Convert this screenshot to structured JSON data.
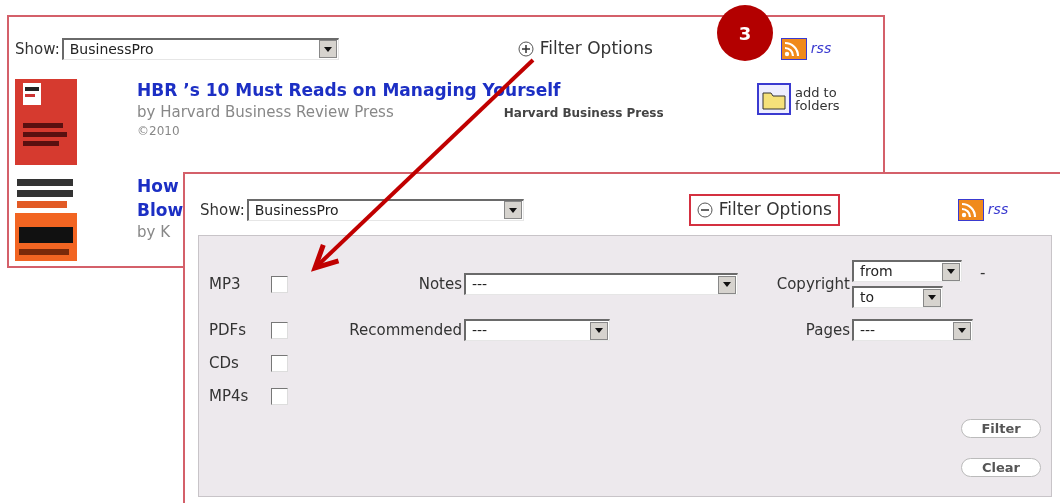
{
  "step_badge": "3",
  "results_panel": {
    "show": {
      "label": "Show:",
      "value": "BusinessPro"
    },
    "filter_toggle": {
      "label": "Filter Options",
      "expanded": false,
      "highlighted": false
    },
    "rss": "rss",
    "results": [
      {
        "title_lines": [
          "HBR ’s 10 Must Reads on Managing Yourself"
        ],
        "byline": "by Harvard Business Review Press",
        "publisher": "Harvard Business Press",
        "copyright": "©2010",
        "action": "add to folders"
      },
      {
        "title_lines": [
          "How",
          "Blow"
        ],
        "byline": "by K"
      }
    ]
  },
  "filter_panel": {
    "show": {
      "label": "Show:",
      "value": "BusinessPro"
    },
    "filter_toggle": {
      "label": "Filter Options",
      "expanded": true,
      "highlighted": true
    },
    "rss": "rss",
    "checkboxes": [
      {
        "label": "MP3",
        "checked": false
      },
      {
        "label": "PDFs",
        "checked": false
      },
      {
        "label": "CDs",
        "checked": false
      },
      {
        "label": "MP4s",
        "checked": false
      }
    ],
    "notes": {
      "label": "Notes",
      "value": "---"
    },
    "recommended": {
      "label": "Recommended",
      "value": "---"
    },
    "copyright": {
      "label": "Copyright",
      "from": "from",
      "to": "to",
      "separator": "-"
    },
    "pages": {
      "label": "Pages",
      "value": "---"
    },
    "buttons": [
      "Filter",
      "Clear"
    ]
  }
}
